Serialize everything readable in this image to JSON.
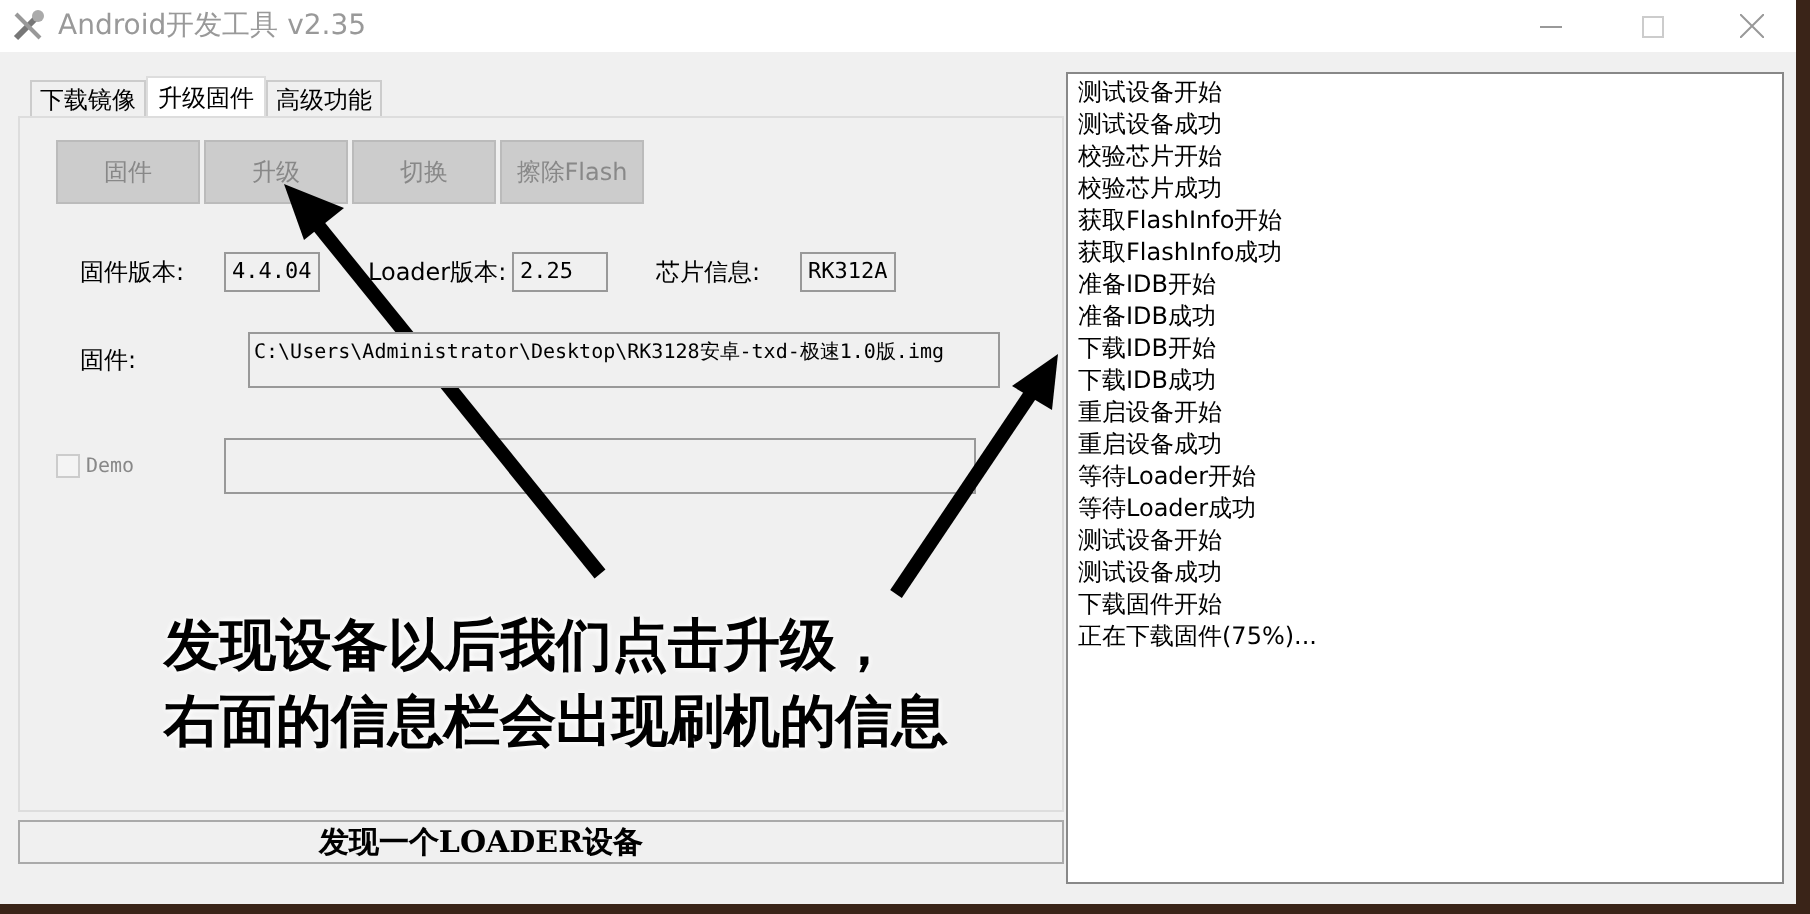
{
  "window": {
    "title": "Android开发工具 v2.35"
  },
  "tabs": [
    {
      "label": "下载镜像",
      "selected": false
    },
    {
      "label": "升级固件",
      "selected": true
    },
    {
      "label": "高级功能",
      "selected": false
    }
  ],
  "buttons": [
    {
      "label": "固件",
      "disabled": true
    },
    {
      "label": "升级",
      "disabled": true
    },
    {
      "label": "切换",
      "disabled": true
    },
    {
      "label": "擦除Flash",
      "disabled": true
    }
  ],
  "info": [
    {
      "label": "固件版本:",
      "value": "4.4.04"
    },
    {
      "label": "Loader版本:",
      "value": "2.25"
    },
    {
      "label": "芯片信息:",
      "value": "RK312A"
    }
  ],
  "firmware": {
    "label": "固件:",
    "value": "C:\\Users\\Administrator\\Desktop\\RK3128安卓-txd-极速1.0版.img"
  },
  "demo": {
    "label": "Demo",
    "checked": false,
    "disabled": true
  },
  "status_bar": "发现一个LOADER设备",
  "log": [
    "测试设备开始",
    "测试设备成功",
    "校验芯片开始",
    "校验芯片成功",
    "获取FlashInfo开始",
    "获取FlashInfo成功",
    "准备IDB开始",
    "准备IDB成功",
    "下载IDB开始",
    "下载IDB成功",
    "重启设备开始",
    "重启设备成功",
    "等待Loader开始",
    "等待Loader成功",
    "测试设备开始",
    "测试设备成功",
    "下载固件开始",
    "正在下载固件(75%)..."
  ],
  "annotation": [
    "发现设备以后我们点击升级，",
    "右面的信息栏会出现刷机的信息"
  ]
}
